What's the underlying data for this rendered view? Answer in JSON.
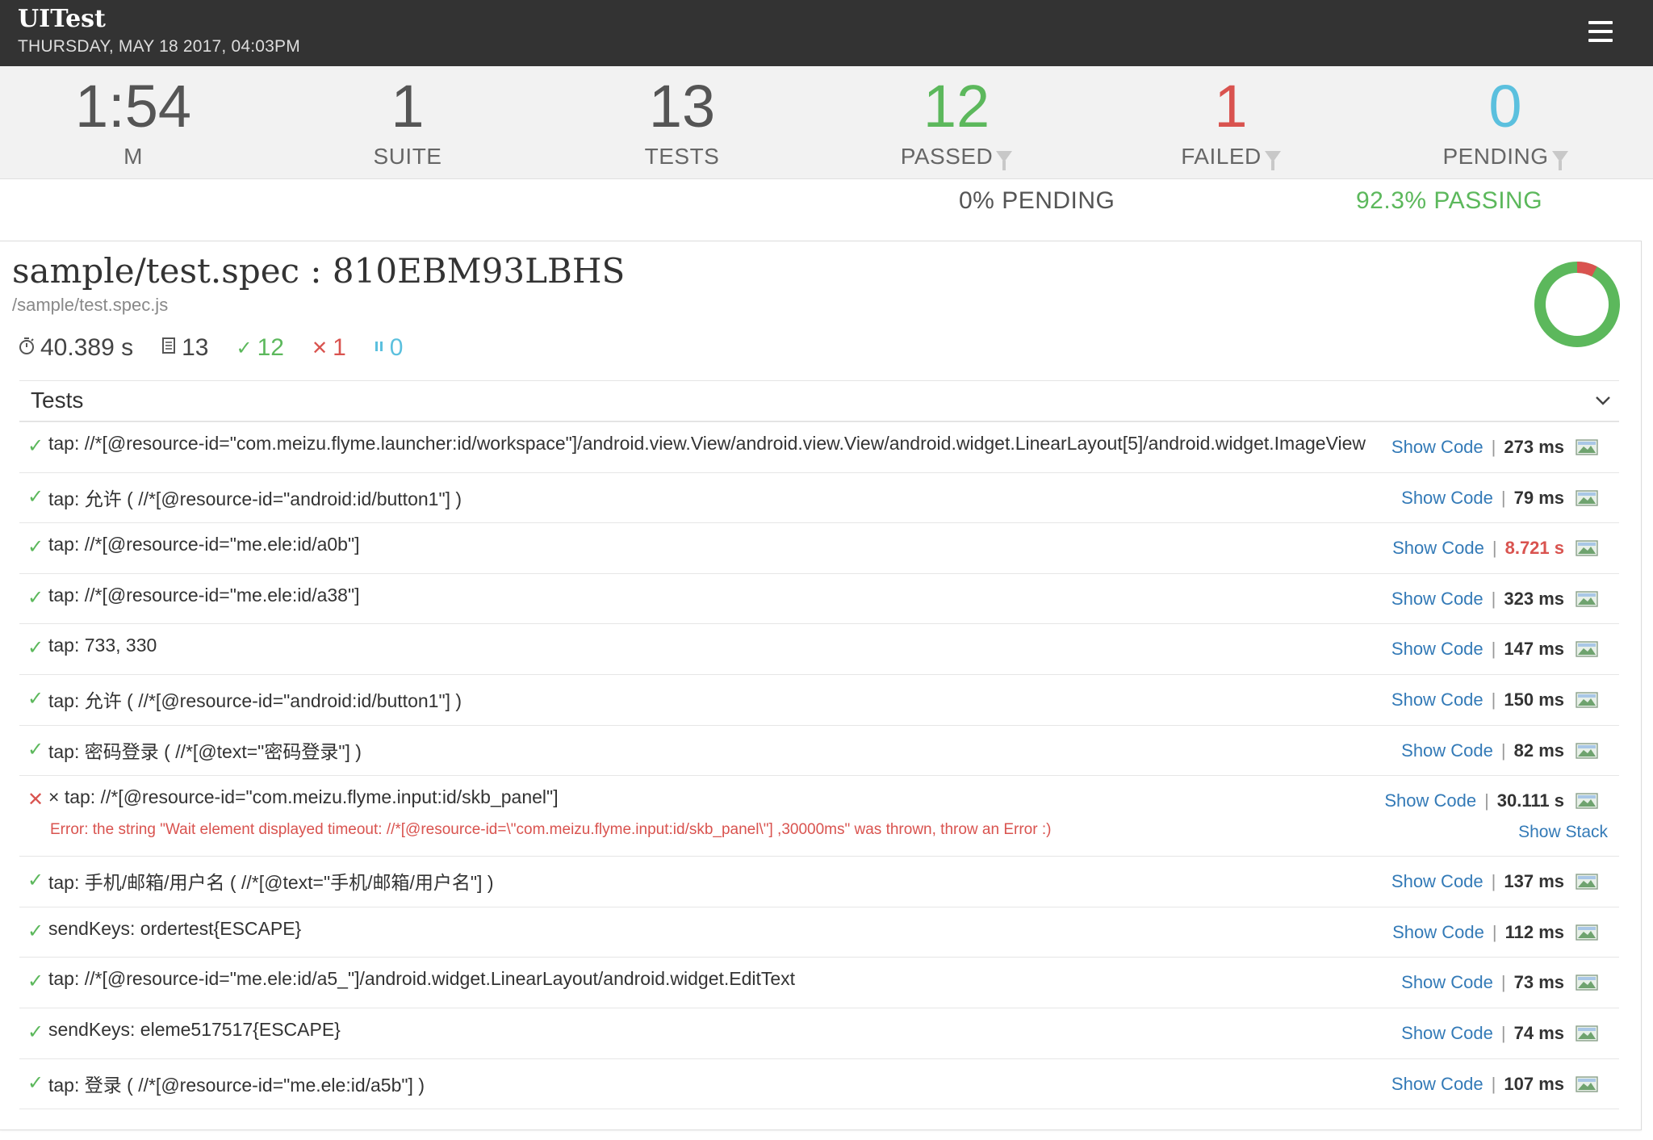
{
  "header": {
    "title": "UITest",
    "date": "THURSDAY, MAY 18 2017, 04:03PM",
    "menu_icon": "hamburger-menu-icon"
  },
  "stats": [
    {
      "value": "1:54",
      "label": "M",
      "color": "#555555",
      "filter": false
    },
    {
      "value": "1",
      "label": "SUITE",
      "color": "#555555",
      "filter": false
    },
    {
      "value": "13",
      "label": "TESTS",
      "color": "#555555",
      "filter": false
    },
    {
      "value": "12",
      "label": "PASSED",
      "color": "#5cb85c",
      "filter": true
    },
    {
      "value": "1",
      "label": "FAILED",
      "color": "#d9534f",
      "filter": true
    },
    {
      "value": "0",
      "label": "PENDING",
      "color": "#5bc0de",
      "filter": true
    }
  ],
  "summary": {
    "pending": "0% PENDING",
    "passing": "92.3% PASSING"
  },
  "suite": {
    "title": "sample/test.spec : 810EBM93LBHS",
    "file": "/sample/test.spec.js",
    "duration": "40.389 s",
    "tests": "13",
    "passed": "12",
    "failed": "1",
    "pending": "0",
    "pass_ratio": 0.923,
    "colors": {
      "pass": "#5cb85c",
      "fail": "#d9534f",
      "pending": "#5bc0de"
    }
  },
  "tests_section": {
    "label": "Tests"
  },
  "tests": [
    {
      "status": "pass",
      "name": "tap: //*[@resource-id=\"com.meizu.flyme.launcher:id/workspace\"]/android.view.View/android.view.View/android.widget.LinearLayout[5]/android.widget.ImageView",
      "code": "Show Code",
      "duration": "273 ms",
      "slow": false
    },
    {
      "status": "pass",
      "name": "tap: 允许 ( //*[@resource-id=\"android:id/button1\"] )",
      "code": "Show Code",
      "duration": "79 ms",
      "slow": false
    },
    {
      "status": "pass",
      "name": "tap: //*[@resource-id=\"me.ele:id/a0b\"]",
      "code": "Show Code",
      "duration": "8.721 s",
      "slow": true
    },
    {
      "status": "pass",
      "name": "tap: //*[@resource-id=\"me.ele:id/a38\"]",
      "code": "Show Code",
      "duration": "323 ms",
      "slow": false
    },
    {
      "status": "pass",
      "name": "tap: 733, 330",
      "code": "Show Code",
      "duration": "147 ms",
      "slow": false
    },
    {
      "status": "pass",
      "name": "tap: 允许 ( //*[@resource-id=\"android:id/button1\"] )",
      "code": "Show Code",
      "duration": "150 ms",
      "slow": false
    },
    {
      "status": "pass",
      "name": "tap: 密码登录 ( //*[@text=\"密码登录\"] )",
      "code": "Show Code",
      "duration": "82 ms",
      "slow": false
    },
    {
      "status": "fail",
      "name": "× tap: //*[@resource-id=\"com.meizu.flyme.input:id/skb_panel\"]",
      "code": "Show Code",
      "duration": "30.111 s",
      "slow": false,
      "error": "Error: the string \"Wait element displayed timeout: //*[@resource-id=\\\"com.meizu.flyme.input:id/skb_panel\\\"] ,30000ms\" was thrown, throw an Error :)",
      "stack": "Show Stack"
    },
    {
      "status": "pass",
      "name": "tap: 手机/邮箱/用户名 ( //*[@text=\"手机/邮箱/用户名\"] )",
      "code": "Show Code",
      "duration": "137 ms",
      "slow": false
    },
    {
      "status": "pass",
      "name": "sendKeys: ordertest{ESCAPE}",
      "code": "Show Code",
      "duration": "112 ms",
      "slow": false
    },
    {
      "status": "pass",
      "name": "tap: //*[@resource-id=\"me.ele:id/a5_\"]/android.widget.LinearLayout/android.widget.EditText",
      "code": "Show Code",
      "duration": "73 ms",
      "slow": false
    },
    {
      "status": "pass",
      "name": "sendKeys: eleme517517{ESCAPE}",
      "code": "Show Code",
      "duration": "74 ms",
      "slow": false
    },
    {
      "status": "pass",
      "name": "tap: 登录 ( //*[@resource-id=\"me.ele:id/a5b\"] )",
      "code": "Show Code",
      "duration": "107 ms",
      "slow": false
    }
  ]
}
